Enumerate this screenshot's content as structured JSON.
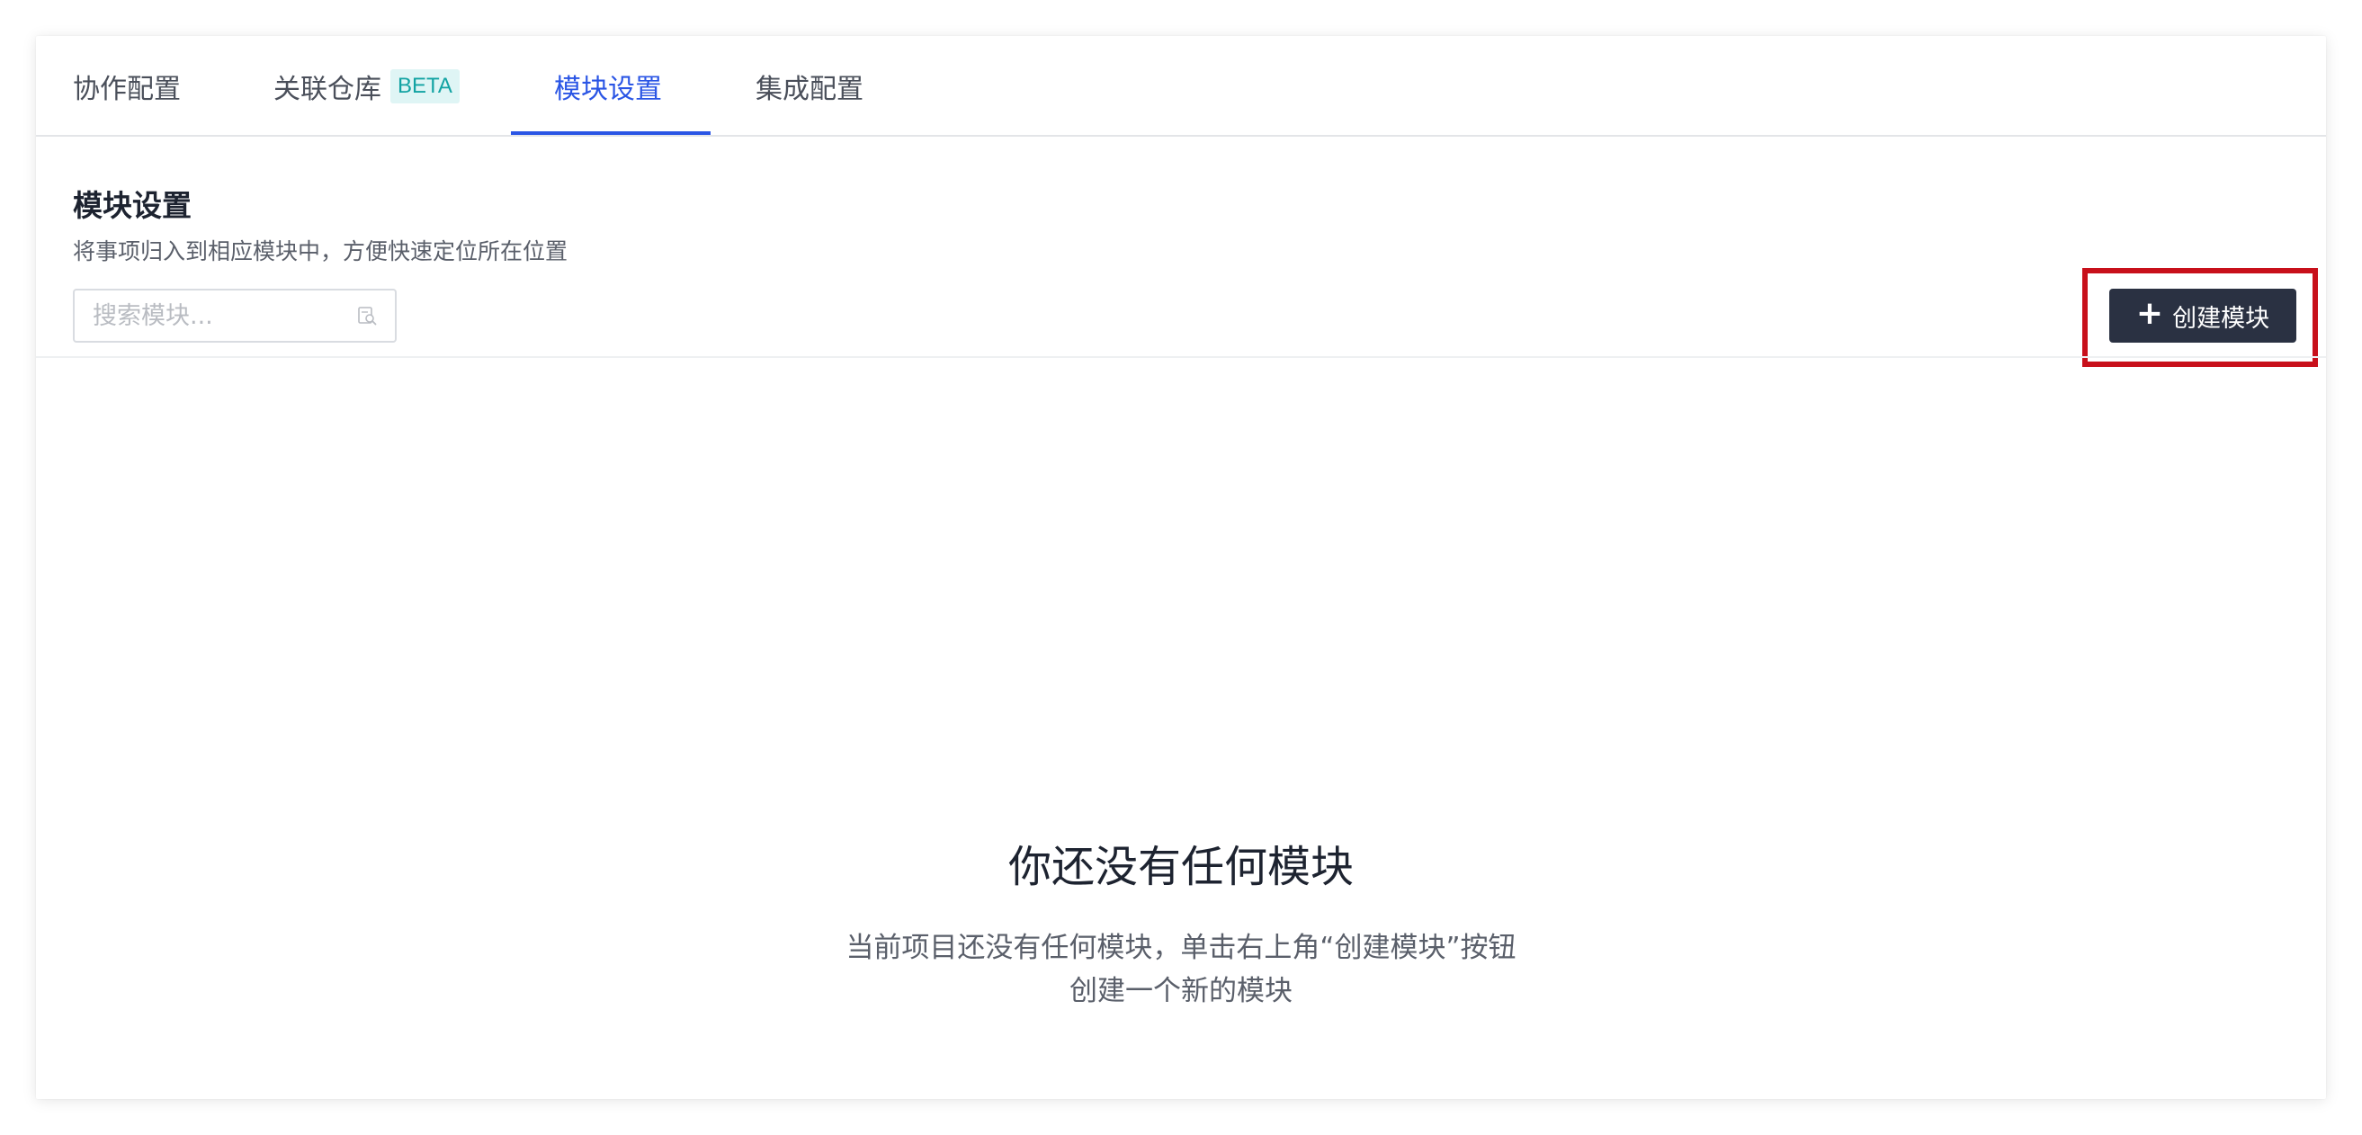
{
  "tabs": [
    {
      "label": "协作配置"
    },
    {
      "label": "关联仓库",
      "badge": "BETA"
    },
    {
      "label": "模块设置",
      "active": true
    },
    {
      "label": "集成配置"
    }
  ],
  "section": {
    "title": "模块设置",
    "description": "将事项归入到相应模块中，方便快速定位所在位置"
  },
  "search": {
    "placeholder": "搜索模块...",
    "value": ""
  },
  "toolbar": {
    "create_label": "创建模块"
  },
  "empty_state": {
    "title": "你还没有任何模块",
    "line1": "当前项目还没有任何模块，单击右上角“创建模块”按钮",
    "line2": "创建一个新的模块"
  },
  "colors": {
    "accent": "#2a55e5",
    "button_bg": "#2a3142",
    "highlight": "#c8101b",
    "badge_text": "#12a3a3",
    "badge_bg": "#dff5f5"
  },
  "icons": {
    "search": "search-icon",
    "create": "plus-icon"
  }
}
